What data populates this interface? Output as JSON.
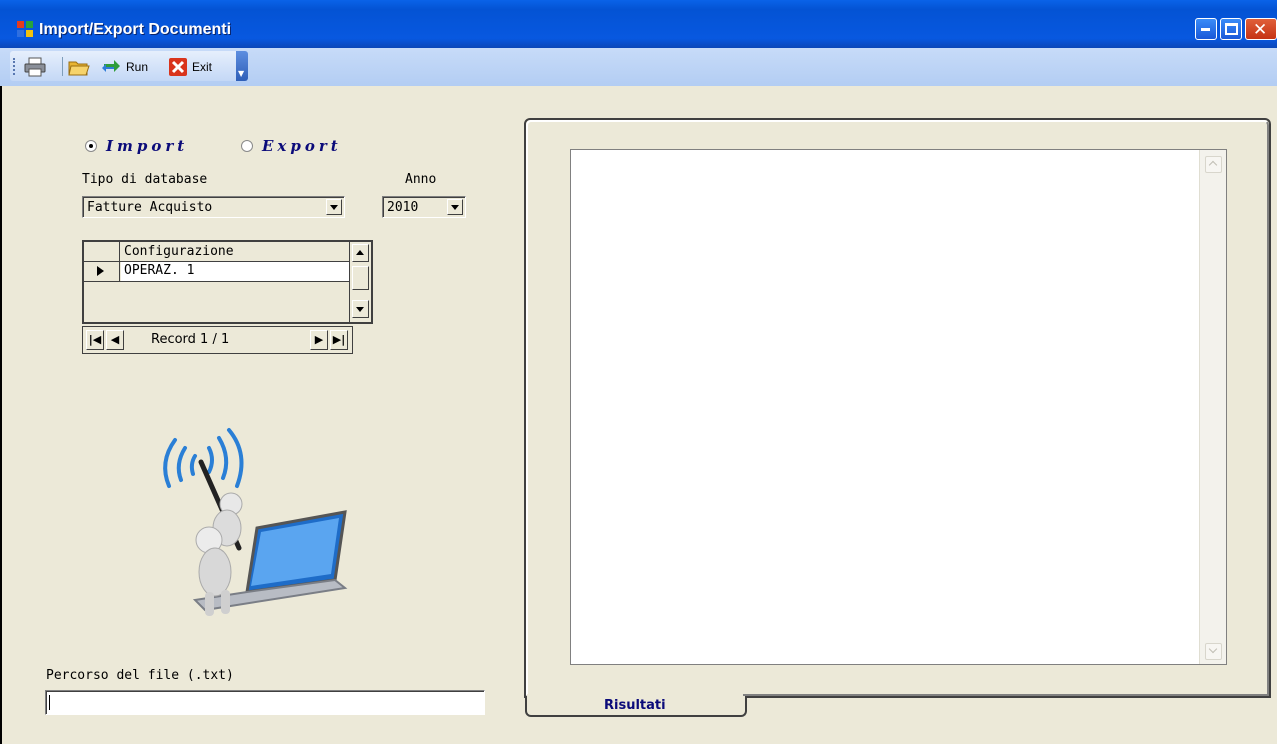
{
  "window": {
    "title": "Import/Export Documenti",
    "controls": [
      "minimize",
      "maximize",
      "close"
    ]
  },
  "toolbar": {
    "items": [
      {
        "icon": "printer-icon",
        "label": ""
      },
      {
        "icon": "open-folder-icon",
        "label": ""
      },
      {
        "icon": "run-arrows-icon",
        "label": "Run"
      },
      {
        "icon": "exit-x-icon",
        "label": "Exit"
      }
    ]
  },
  "mode": {
    "import_label": "Import",
    "export_label": "Export",
    "selected": "Import"
  },
  "database": {
    "label": "Tipo di database",
    "value": "Fatture Acquisto"
  },
  "year": {
    "label": "Anno",
    "value": "2010"
  },
  "grid": {
    "column": "Configurazione",
    "rows": [
      "OPERAZ. 1"
    ]
  },
  "navigator": {
    "text": "Record 1 / 1"
  },
  "file": {
    "label": "Percorso del file (.txt)",
    "value": ""
  },
  "results_tab": {
    "label": "Risultati"
  },
  "colors": {
    "accent_label": "#0b0b7a",
    "titlebar": "#0453d4",
    "window_bg": "#ece9d8"
  }
}
